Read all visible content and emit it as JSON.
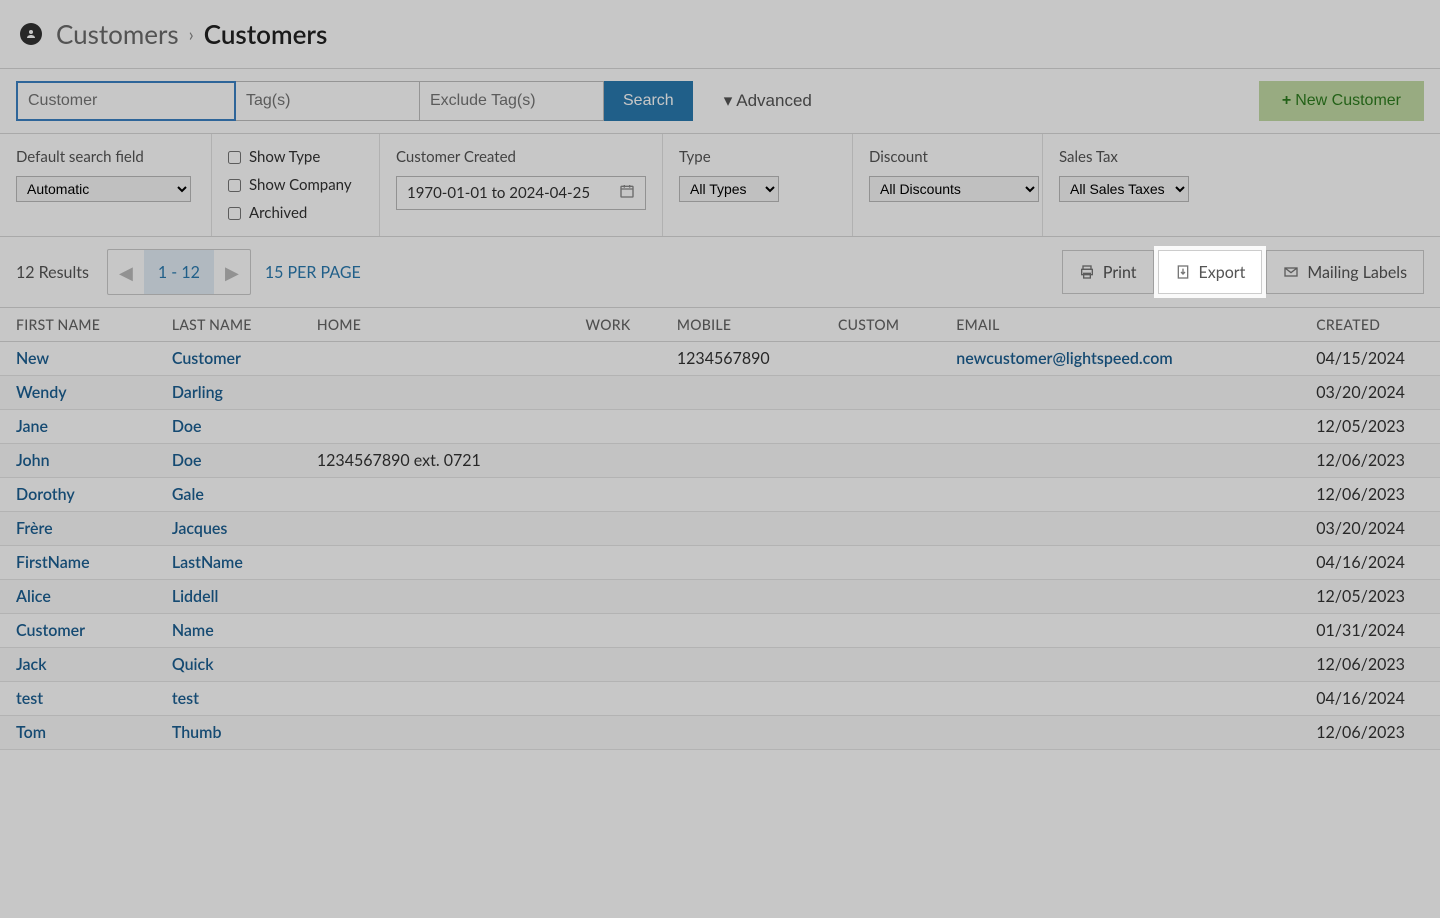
{
  "breadcrumb": {
    "parent": "Customers",
    "current": "Customers"
  },
  "search": {
    "customer_placeholder": "Customer",
    "tags_placeholder": "Tag(s)",
    "exclude_placeholder": "Exclude Tag(s)",
    "search_label": "Search",
    "advanced_label": "Advanced",
    "new_customer_label": "New Customer"
  },
  "filters": {
    "default_search_label": "Default search field",
    "default_search_value": "Automatic",
    "show_type_label": "Show Type",
    "show_company_label": "Show Company",
    "archived_label": "Archived",
    "customer_created_label": "Customer Created",
    "date_range_value": "1970-01-01 to 2024-04-25",
    "type_label": "Type",
    "type_value": "All Types",
    "discount_label": "Discount",
    "discount_value": "All Discounts",
    "tax_label": "Sales Tax",
    "tax_value": "All Sales Taxes"
  },
  "toolbar": {
    "results_count": "12 Results",
    "page_range": "1 - 12",
    "per_page": "15 PER PAGE",
    "print_label": "Print",
    "export_label": "Export",
    "mailing_label": "Mailing Labels"
  },
  "columns": {
    "first": "FIRST NAME",
    "last": "LAST NAME",
    "home": "HOME",
    "work": "WORK",
    "mobile": "MOBILE",
    "custom": "CUSTOM",
    "email": "EMAIL",
    "created": "CREATED"
  },
  "rows": [
    {
      "first": "New",
      "last": "Customer",
      "home": "",
      "work": "",
      "mobile": "1234567890",
      "custom": "",
      "email": "newcustomer@lightspeed.com",
      "created": "04/15/2024"
    },
    {
      "first": "Wendy",
      "last": "Darling",
      "home": "",
      "work": "",
      "mobile": "",
      "custom": "",
      "email": "",
      "created": "03/20/2024"
    },
    {
      "first": "Jane",
      "last": "Doe",
      "home": "",
      "work": "",
      "mobile": "",
      "custom": "",
      "email": "",
      "created": "12/05/2023"
    },
    {
      "first": "John",
      "last": "Doe",
      "home": "1234567890 ext. 0721",
      "work": "",
      "mobile": "",
      "custom": "",
      "email": "",
      "created": "12/06/2023"
    },
    {
      "first": "Dorothy",
      "last": "Gale",
      "home": "",
      "work": "",
      "mobile": "",
      "custom": "",
      "email": "",
      "created": "12/06/2023"
    },
    {
      "first": "Frère",
      "last": "Jacques",
      "home": "",
      "work": "",
      "mobile": "",
      "custom": "",
      "email": "",
      "created": "03/20/2024"
    },
    {
      "first": "FirstName",
      "last": "LastName",
      "home": "",
      "work": "",
      "mobile": "",
      "custom": "",
      "email": "",
      "created": "04/16/2024"
    },
    {
      "first": "Alice",
      "last": "Liddell",
      "home": "",
      "work": "",
      "mobile": "",
      "custom": "",
      "email": "",
      "created": "12/05/2023"
    },
    {
      "first": "Customer",
      "last": "Name",
      "home": "",
      "work": "",
      "mobile": "",
      "custom": "",
      "email": "",
      "created": "01/31/2024"
    },
    {
      "first": "Jack",
      "last": "Quick",
      "home": "",
      "work": "",
      "mobile": "",
      "custom": "",
      "email": "",
      "created": "12/06/2023"
    },
    {
      "first": "test",
      "last": "test",
      "home": "",
      "work": "",
      "mobile": "",
      "custom": "",
      "email": "",
      "created": "04/16/2024"
    },
    {
      "first": "Tom",
      "last": "Thumb",
      "home": "",
      "work": "",
      "mobile": "",
      "custom": "",
      "email": "",
      "created": "12/06/2023"
    }
  ]
}
